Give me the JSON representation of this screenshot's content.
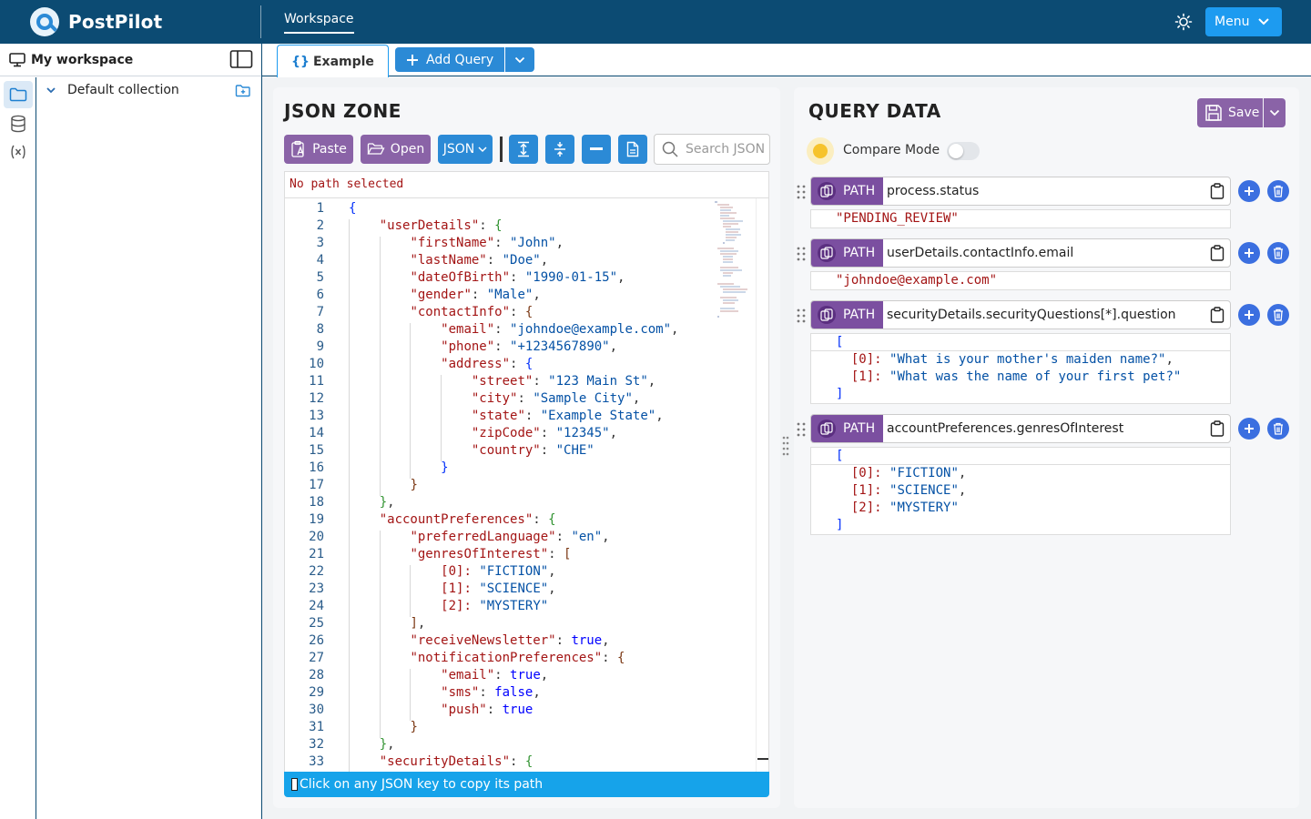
{
  "app": {
    "name": "PostPilot"
  },
  "header": {
    "workspace_tab": "Workspace",
    "menu_label": "Menu"
  },
  "sidebar": {
    "workspace_label": "My workspace",
    "collection_label": "Default collection"
  },
  "tabs": {
    "active_tab": "Example",
    "add_query_label": "Add Query"
  },
  "json_zone": {
    "title": "JSON ZONE",
    "paste_label": "Paste",
    "open_label": "Open",
    "format_label": "JSON",
    "search_placeholder": "Search JSON",
    "path_status": "No path selected",
    "status_hint": "Click on any JSON key to copy its path",
    "lines": [
      {
        "n": "1",
        "i": 0,
        "t": [
          [
            "{",
            "br1"
          ]
        ]
      },
      {
        "n": "2",
        "i": 1,
        "t": [
          [
            "\"userDetails\"",
            "k"
          ],
          [
            ": ",
            "p"
          ],
          [
            "{",
            "br2"
          ]
        ]
      },
      {
        "n": "3",
        "i": 2,
        "t": [
          [
            "\"firstName\"",
            "k"
          ],
          [
            ": ",
            "p"
          ],
          [
            "\"John\"",
            "s"
          ],
          [
            ",",
            "p"
          ]
        ]
      },
      {
        "n": "4",
        "i": 2,
        "t": [
          [
            "\"lastName\"",
            "k"
          ],
          [
            ": ",
            "p"
          ],
          [
            "\"Doe\"",
            "s"
          ],
          [
            ",",
            "p"
          ]
        ]
      },
      {
        "n": "5",
        "i": 2,
        "t": [
          [
            "\"dateOfBirth\"",
            "k"
          ],
          [
            ": ",
            "p"
          ],
          [
            "\"1990-01-15\"",
            "s"
          ],
          [
            ",",
            "p"
          ]
        ]
      },
      {
        "n": "6",
        "i": 2,
        "t": [
          [
            "\"gender\"",
            "k"
          ],
          [
            ": ",
            "p"
          ],
          [
            "\"Male\"",
            "s"
          ],
          [
            ",",
            "p"
          ]
        ]
      },
      {
        "n": "7",
        "i": 2,
        "t": [
          [
            "\"contactInfo\"",
            "k"
          ],
          [
            ": ",
            "p"
          ],
          [
            "{",
            "br3"
          ]
        ]
      },
      {
        "n": "8",
        "i": 3,
        "t": [
          [
            "\"email\"",
            "k"
          ],
          [
            ": ",
            "p"
          ],
          [
            "\"johndoe@example.com\"",
            "s"
          ],
          [
            ",",
            "p"
          ]
        ]
      },
      {
        "n": "9",
        "i": 3,
        "t": [
          [
            "\"phone\"",
            "k"
          ],
          [
            ": ",
            "p"
          ],
          [
            "\"+1234567890\"",
            "s"
          ],
          [
            ",",
            "p"
          ]
        ]
      },
      {
        "n": "10",
        "i": 3,
        "t": [
          [
            "\"address\"",
            "k"
          ],
          [
            ": ",
            "p"
          ],
          [
            "{",
            "br1"
          ]
        ]
      },
      {
        "n": "11",
        "i": 4,
        "t": [
          [
            "\"street\"",
            "k"
          ],
          [
            ": ",
            "p"
          ],
          [
            "\"123 Main St\"",
            "s"
          ],
          [
            ",",
            "p"
          ]
        ]
      },
      {
        "n": "12",
        "i": 4,
        "t": [
          [
            "\"city\"",
            "k"
          ],
          [
            ": ",
            "p"
          ],
          [
            "\"Sample City\"",
            "s"
          ],
          [
            ",",
            "p"
          ]
        ]
      },
      {
        "n": "13",
        "i": 4,
        "t": [
          [
            "\"state\"",
            "k"
          ],
          [
            ": ",
            "p"
          ],
          [
            "\"Example State\"",
            "s"
          ],
          [
            ",",
            "p"
          ]
        ]
      },
      {
        "n": "14",
        "i": 4,
        "t": [
          [
            "\"zipCode\"",
            "k"
          ],
          [
            ": ",
            "p"
          ],
          [
            "\"12345\"",
            "s"
          ],
          [
            ",",
            "p"
          ]
        ]
      },
      {
        "n": "15",
        "i": 4,
        "t": [
          [
            "\"country\"",
            "k"
          ],
          [
            ": ",
            "p"
          ],
          [
            "\"CHE\"",
            "s"
          ]
        ]
      },
      {
        "n": "16",
        "i": 3,
        "t": [
          [
            "}",
            "br1"
          ]
        ]
      },
      {
        "n": "17",
        "i": 2,
        "t": [
          [
            "}",
            "br3"
          ]
        ]
      },
      {
        "n": "18",
        "i": 1,
        "t": [
          [
            "}",
            "br2"
          ],
          [
            ",",
            "p"
          ]
        ]
      },
      {
        "n": "19",
        "i": 1,
        "t": [
          [
            "\"accountPreferences\"",
            "k"
          ],
          [
            ": ",
            "p"
          ],
          [
            "{",
            "br2"
          ]
        ]
      },
      {
        "n": "20",
        "i": 2,
        "t": [
          [
            "\"preferredLanguage\"",
            "k"
          ],
          [
            ": ",
            "p"
          ],
          [
            "\"en\"",
            "s"
          ],
          [
            ",",
            "p"
          ]
        ]
      },
      {
        "n": "21",
        "i": 2,
        "t": [
          [
            "\"genresOfInterest\"",
            "k"
          ],
          [
            ": ",
            "p"
          ],
          [
            "[",
            "br3"
          ]
        ]
      },
      {
        "n": "22",
        "i": 3,
        "t": [
          [
            "[0]: ",
            "k"
          ],
          [
            "\"FICTION\"",
            "s"
          ],
          [
            ",",
            "p"
          ]
        ]
      },
      {
        "n": "23",
        "i": 3,
        "t": [
          [
            "[1]: ",
            "k"
          ],
          [
            "\"SCIENCE\"",
            "s"
          ],
          [
            ",",
            "p"
          ]
        ]
      },
      {
        "n": "24",
        "i": 3,
        "t": [
          [
            "[2]: ",
            "k"
          ],
          [
            "\"MYSTERY\"",
            "s"
          ]
        ]
      },
      {
        "n": "25",
        "i": 2,
        "t": [
          [
            "]",
            "br3"
          ],
          [
            ",",
            "p"
          ]
        ]
      },
      {
        "n": "26",
        "i": 2,
        "t": [
          [
            "\"receiveNewsletter\"",
            "k"
          ],
          [
            ": ",
            "p"
          ],
          [
            "true",
            "b"
          ],
          [
            ",",
            "p"
          ]
        ]
      },
      {
        "n": "27",
        "i": 2,
        "t": [
          [
            "\"notificationPreferences\"",
            "k"
          ],
          [
            ": ",
            "p"
          ],
          [
            "{",
            "br3"
          ]
        ]
      },
      {
        "n": "28",
        "i": 3,
        "t": [
          [
            "\"email\"",
            "k"
          ],
          [
            ": ",
            "p"
          ],
          [
            "true",
            "b"
          ],
          [
            ",",
            "p"
          ]
        ]
      },
      {
        "n": "29",
        "i": 3,
        "t": [
          [
            "\"sms\"",
            "k"
          ],
          [
            ": ",
            "p"
          ],
          [
            "false",
            "b"
          ],
          [
            ",",
            "p"
          ]
        ]
      },
      {
        "n": "30",
        "i": 3,
        "t": [
          [
            "\"push\"",
            "k"
          ],
          [
            ": ",
            "p"
          ],
          [
            "true",
            "b"
          ]
        ]
      },
      {
        "n": "31",
        "i": 2,
        "t": [
          [
            "}",
            "br3"
          ]
        ]
      },
      {
        "n": "32",
        "i": 1,
        "t": [
          [
            "}",
            "br2"
          ],
          [
            ",",
            "p"
          ]
        ]
      },
      {
        "n": "33",
        "i": 1,
        "t": [
          [
            "\"securityDetails\"",
            "k"
          ],
          [
            ": ",
            "p"
          ],
          [
            "{",
            "br2"
          ]
        ]
      }
    ]
  },
  "query_data": {
    "title": "QUERY DATA",
    "save_label": "Save",
    "compare_label": "Compare Mode",
    "compare_enabled": false,
    "path_tag": "PATH",
    "queries": [
      {
        "path": "process.status",
        "result": [
          [
            "\"PENDING_REVIEW\"",
            "",
            ""
          ]
        ]
      },
      {
        "path": "userDetails.contactInfo.email",
        "result": [
          [
            "\"johndoe@example.com\"",
            "",
            ""
          ]
        ]
      },
      {
        "path": "securityDetails.securityQuestions[*].question",
        "result": [
          [
            "[",
            "",
            ""
          ],
          [
            "  [0]: ",
            "\"What is your mother's maiden name?\"",
            ","
          ],
          [
            "  [1]: ",
            "\"What was the name of your first pet?\"",
            ""
          ],
          [
            "]",
            "",
            ""
          ]
        ]
      },
      {
        "path": "accountPreferences.genresOfInterest",
        "result": [
          [
            "[",
            "",
            ""
          ],
          [
            "  [0]: ",
            "\"FICTION\"",
            ","
          ],
          [
            "  [1]: ",
            "\"SCIENCE\"",
            ","
          ],
          [
            "  [2]: ",
            "\"MYSTERY\"",
            ""
          ],
          [
            "]",
            "",
            ""
          ]
        ]
      }
    ]
  },
  "colors": {
    "header": "#0c4b73",
    "accent": "#2b8ad6",
    "purple": "#8a63a7",
    "status": "#16a3ea"
  },
  "icons": [
    "logo-icon",
    "sun-icon",
    "chevron-down-icon",
    "monitor-icon",
    "sidebar-toggle-icon",
    "folder-icon",
    "database-icon",
    "variable-icon",
    "add-folder-icon",
    "braces-icon",
    "plus-icon",
    "paste-icon",
    "folder-open-icon",
    "expand-icon",
    "collapse-icon",
    "minus-icon",
    "file-icon",
    "search-icon",
    "save-icon",
    "bulb-icon",
    "copy-icon",
    "clipboard-icon",
    "trash-icon",
    "drag-handle-icon"
  ]
}
